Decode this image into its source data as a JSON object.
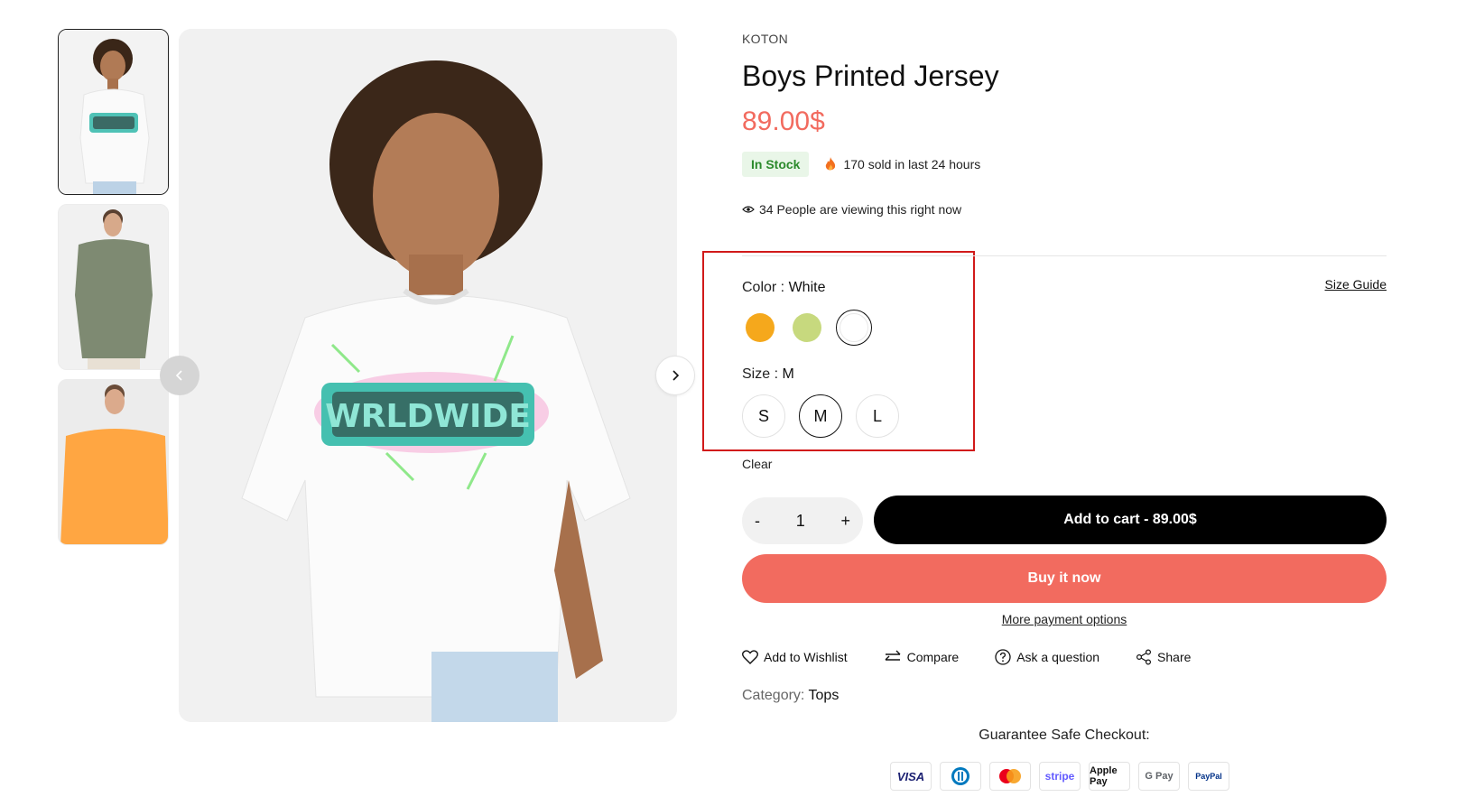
{
  "product": {
    "vendor": "KOTON",
    "title": "Boys Printed Jersey",
    "price": "89.00$",
    "stock_label": "In Stock",
    "sold_text": "170 sold in last 24 hours",
    "viewing_text": "34 People are viewing this right now"
  },
  "gallery": {
    "thumbnails": [
      {
        "alt": "Boy in white printed t-shirt"
      },
      {
        "alt": "Man in green t-shirt"
      },
      {
        "alt": "Man in orange t-shirt"
      }
    ],
    "main_print_text": "WRLDWIDE"
  },
  "options": {
    "size_guide": "Size Guide",
    "color_label": "Color : ",
    "color_value": "White",
    "colors": [
      {
        "name": "Orange",
        "hex": "#f5a81c"
      },
      {
        "name": "Green",
        "hex": "#c7d97e"
      },
      {
        "name": "White",
        "hex": "#ffffff"
      }
    ],
    "size_label": "Size : ",
    "size_value": "M",
    "sizes": [
      "S",
      "M",
      "L"
    ],
    "clear_label": "Clear"
  },
  "cart": {
    "minus": "-",
    "quantity": "1",
    "plus": "+",
    "add_to_cart": "Add to cart - 89.00$",
    "buy_now": "Buy it now",
    "more_payment": "More payment options"
  },
  "actions": {
    "wishlist": "Add to Wishlist",
    "compare": "Compare",
    "ask": "Ask a question",
    "share": "Share"
  },
  "meta": {
    "category_label": "Category: ",
    "category_value": "Tops",
    "guarantee": "Guarantee Safe Checkout:",
    "payments": [
      "VISA",
      "Diners",
      "Mastercard",
      "stripe",
      "Apple Pay",
      "G Pay",
      "PayPal"
    ]
  },
  "colors": {
    "accent": "#f26b5f",
    "stock_bg": "#e9f6e8",
    "stock_text": "#2c8a2c",
    "highlight": "#d11a1a"
  }
}
